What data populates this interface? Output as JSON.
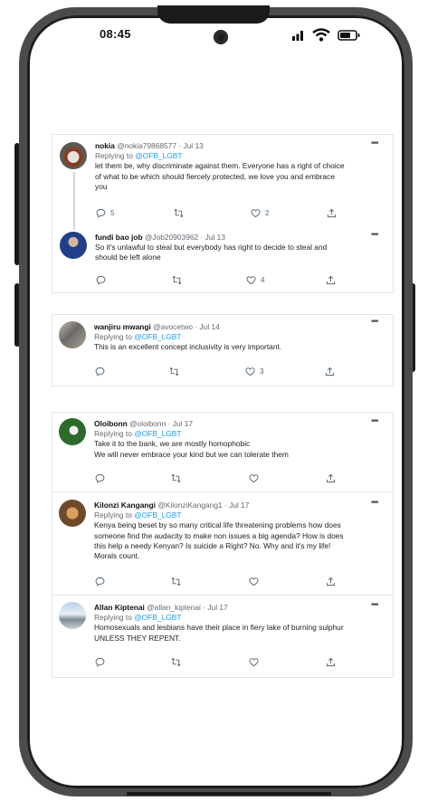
{
  "status": {
    "time": "08:45"
  },
  "reply_prefix": "Replying to",
  "tweets": [
    {
      "name": "nokia",
      "handle": "@nokia79868577",
      "date": "· Jul 13",
      "reply_to": "@OFB_LGBT",
      "lines": [
        "let them be, why discriminate against them. Everyone has a right of choice",
        "of what to be which should fiercely protected, we love you and embrace",
        "you"
      ],
      "replies": "5",
      "retweets": "",
      "likes": "2"
    },
    {
      "name": "fundi bao job",
      "handle": "@Job20903962",
      "date": "· Jul 13",
      "reply_to": "",
      "lines": [
        "So it's unlawful to steal but everybody has right to decide to steal and",
        "should be left alone"
      ],
      "replies": "",
      "retweets": "",
      "likes": "4"
    },
    {
      "name": "wanjiru mwangi",
      "handle": "@avocetwo",
      "date": "· Jul 14",
      "reply_to": "@OFB_LGBT",
      "lines": [
        "This is an excellent concept  inclusivity is very important."
      ],
      "replies": "",
      "retweets": "",
      "likes": "3"
    },
    {
      "name": "Oloibonn",
      "handle": "@oloibonn",
      "date": "· Jul 17",
      "reply_to": "@OFB_LGBT",
      "lines": [
        "Take it to the bank, we are mostly homophobic",
        "We will never embrace your kind but we can tolerate them"
      ],
      "replies": "",
      "retweets": "",
      "likes": ""
    },
    {
      "name": "Kilonzi Kangangi",
      "handle": "@KilonziKangang1",
      "date": "· Jul 17",
      "reply_to": "@OFB_LGBT",
      "lines": [
        "Kenya being beset by so many critical life threatening problems how does",
        "someone find the audacity to make non issues a big agenda? How is does",
        "this help a needy Kenyan? Is suicide a Right? No. Why and it's my life!",
        "Morals count."
      ],
      "replies": "",
      "retweets": "",
      "likes": ""
    },
    {
      "name": "Allan Kiptenai",
      "handle": "@allan_kiptenai",
      "date": "· Jul 17",
      "reply_to": "@OFB_LGBT",
      "lines": [
        "Homosexuals and lesbians have their place in fiery lake of burning sulphur",
        "UNLESS THEY REPENT."
      ],
      "replies": "",
      "retweets": "",
      "likes": ""
    }
  ],
  "colors": {
    "link": "#1d9bf0",
    "frame": "#4b4b4b",
    "icon": "#536471"
  },
  "icons": [
    "reply-icon",
    "retweet-icon",
    "like-icon",
    "share-icon",
    "more-icon",
    "signal-icon",
    "wifi-icon",
    "battery-icon"
  ]
}
